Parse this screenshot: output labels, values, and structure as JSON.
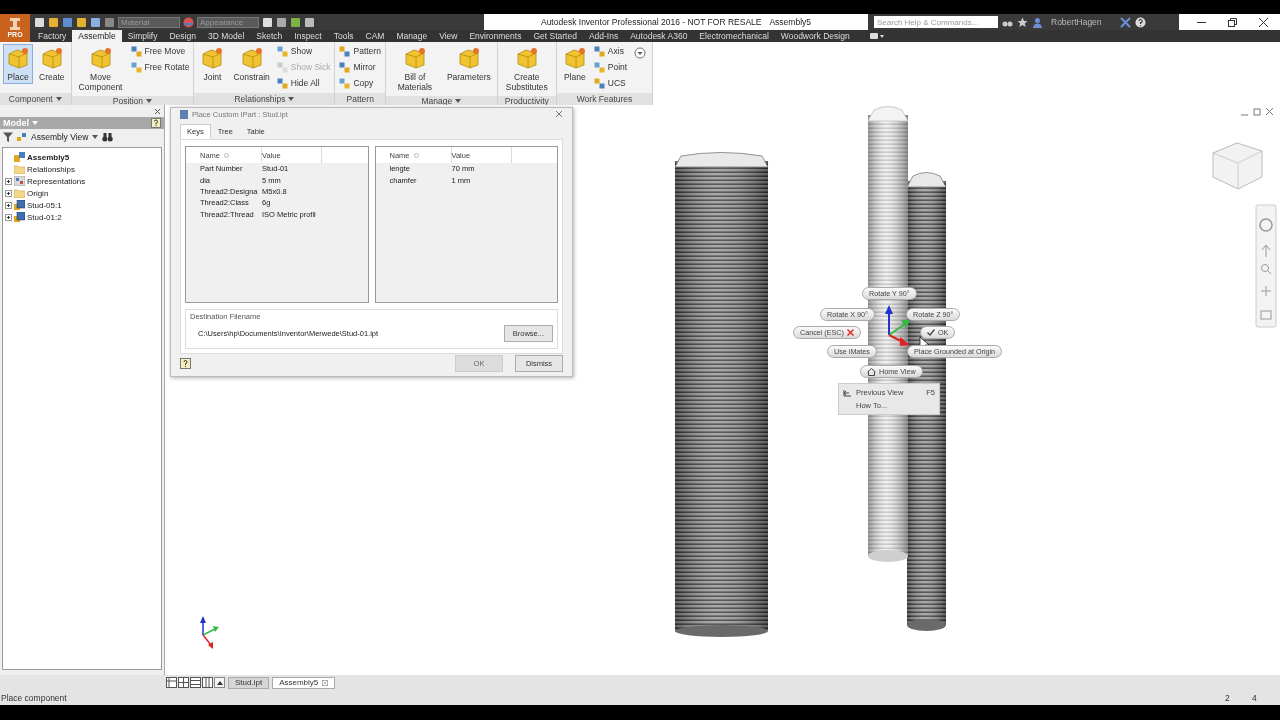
{
  "app_button": {
    "label": "PRO"
  },
  "title_bar": {
    "material_placeholder": "Material",
    "appearance_placeholder": "Appearance",
    "title": "Autodesk Inventor Professional 2016 - NOT FOR RESALE",
    "document": "Assembly5",
    "search_placeholder": "Search Help & Commands...",
    "user": "RobertHagen"
  },
  "ribbon_tabs": [
    {
      "label": "Factory",
      "selected": false
    },
    {
      "label": "Assemble",
      "selected": true
    },
    {
      "label": "Simplify",
      "selected": false
    },
    {
      "label": "Design",
      "selected": false
    },
    {
      "label": "3D Model",
      "selected": false
    },
    {
      "label": "Sketch",
      "selected": false
    },
    {
      "label": "Inspect",
      "selected": false
    },
    {
      "label": "Tools",
      "selected": false
    },
    {
      "label": "CAM",
      "selected": false
    },
    {
      "label": "Manage",
      "selected": false
    },
    {
      "label": "View",
      "selected": false
    },
    {
      "label": "Environments",
      "selected": false
    },
    {
      "label": "Get Started",
      "selected": false
    },
    {
      "label": "Add-Ins",
      "selected": false
    },
    {
      "label": "Autodesk A360",
      "selected": false
    },
    {
      "label": "Electromechanical",
      "selected": false
    },
    {
      "label": "Woodwork Design",
      "selected": false
    }
  ],
  "ribbon_panels": [
    {
      "title": "Component",
      "has_menu": true,
      "tools": [
        {
          "label": "Place",
          "kind": "large",
          "selected": true,
          "disabled": false
        },
        {
          "label": "Create",
          "kind": "large",
          "selected": false,
          "disabled": false
        }
      ]
    },
    {
      "title": "Position",
      "has_menu": true,
      "tools": [
        {
          "label": "Move Component",
          "kind": "large",
          "selected": false,
          "disabled": false
        },
        {
          "label": "Free Move",
          "kind": "small",
          "selected": false,
          "disabled": false
        },
        {
          "label": "Free Rotate",
          "kind": "small",
          "selected": false,
          "disabled": false
        }
      ]
    },
    {
      "title": "Relationships",
      "has_menu": true,
      "tools": [
        {
          "label": "Joint",
          "kind": "large",
          "selected": false,
          "disabled": false
        },
        {
          "label": "Constrain",
          "kind": "large",
          "selected": false,
          "disabled": false
        },
        {
          "label": "Show",
          "kind": "small",
          "selected": false,
          "disabled": false
        },
        {
          "label": "Show Sick",
          "kind": "small",
          "selected": false,
          "disabled": true
        },
        {
          "label": "Hide All",
          "kind": "small",
          "selected": false,
          "disabled": false
        }
      ]
    },
    {
      "title": "Pattern",
      "has_menu": false,
      "tools": [
        {
          "label": "Pattern",
          "kind": "small",
          "selected": false,
          "disabled": false
        },
        {
          "label": "Mirror",
          "kind": "small",
          "selected": false,
          "disabled": false
        },
        {
          "label": "Copy",
          "kind": "small",
          "selected": false,
          "disabled": false
        }
      ]
    },
    {
      "title": "Manage",
      "has_menu": true,
      "tools": [
        {
          "label": "Bill of Materials",
          "kind": "large",
          "selected": false,
          "disabled": false
        },
        {
          "label": "Parameters",
          "kind": "large",
          "selected": false,
          "disabled": false
        }
      ]
    },
    {
      "title": "Productivity",
      "has_menu": false,
      "tools": [
        {
          "label": "Create Substitutes",
          "kind": "large",
          "selected": false,
          "disabled": false
        }
      ]
    },
    {
      "title": "Work Features",
      "has_menu": false,
      "tools": [
        {
          "label": "Plane",
          "kind": "large",
          "selected": false,
          "disabled": false
        },
        {
          "label": "Axis",
          "kind": "small",
          "selected": false,
          "disabled": false
        },
        {
          "label": "Point",
          "kind": "small",
          "selected": false,
          "disabled": false
        },
        {
          "label": "UCS",
          "kind": "small",
          "selected": false,
          "disabled": false
        }
      ]
    }
  ],
  "model_browser": {
    "title": "Model",
    "view": "Assembly View",
    "tree": {
      "label": "Assembly5",
      "kind": "assembly",
      "children": [
        {
          "label": "Relationships",
          "kind": "folder"
        },
        {
          "label": "Representations",
          "kind": "representations",
          "expanded": false
        },
        {
          "label": "Origin",
          "kind": "folder",
          "expanded": false
        },
        {
          "label": "Stud-05:1",
          "kind": "part",
          "expanded": false
        },
        {
          "label": "Stud-01:2",
          "kind": "part",
          "expanded": false
        }
      ]
    }
  },
  "dialog": {
    "title": "Place Custom iPart : Stud.ipt",
    "tabs": [
      {
        "label": "Keys",
        "selected": true
      },
      {
        "label": "Tree",
        "selected": false
      },
      {
        "label": "Table",
        "selected": false
      }
    ],
    "lists": [
      {
        "columns": [
          "Name",
          "Value"
        ],
        "rows": [
          [
            "Part Number",
            "Stud-01"
          ],
          [
            "dia",
            "5 mm"
          ],
          [
            "Thread2:Designa",
            "M5x0.8"
          ],
          [
            "Thread2:Class",
            "6g"
          ],
          [
            "Thread2:Thread",
            "ISO Metric profil"
          ]
        ]
      },
      {
        "columns": [
          "Name",
          "Value"
        ],
        "rows": [
          [
            "lengte",
            "70 mm"
          ],
          [
            "chamfer",
            "1 mm"
          ]
        ]
      }
    ],
    "destination_label": "Destination Filename",
    "destination_path": "C:\\Users\\hp\\Documents\\Inventor\\Merwede\\Stud-01.ipt",
    "browse_button": "Browse...",
    "buttons": [
      {
        "label": "OK",
        "disabled": true
      },
      {
        "label": "Dismiss",
        "disabled": false
      }
    ]
  },
  "marking_menu": {
    "items": [
      {
        "label": "Rotate Y 90°",
        "kind": "plain"
      },
      {
        "label": "Rotate X 90°",
        "kind": "plain"
      },
      {
        "label": "Rotate Z 90°",
        "kind": "plain"
      },
      {
        "label": "Cancel (ESC)",
        "kind": "cancel"
      },
      {
        "label": "OK",
        "kind": "ok"
      },
      {
        "label": "Use iMates",
        "kind": "plain"
      },
      {
        "label": "Place Grounded at Origin",
        "kind": "plain"
      },
      {
        "label": "Home View",
        "kind": "home"
      }
    ],
    "overflow": [
      {
        "label": "Previous View",
        "shortcut": "F5",
        "kind": "previous"
      },
      {
        "label": "How To...",
        "kind": "plain"
      }
    ]
  },
  "document_tabs": [
    {
      "label": "Stud.ipt",
      "selected": false
    },
    {
      "label": "Assembly5",
      "selected": true
    }
  ],
  "status_bar": {
    "message": "Place component",
    "values": [
      "2",
      "4"
    ]
  }
}
